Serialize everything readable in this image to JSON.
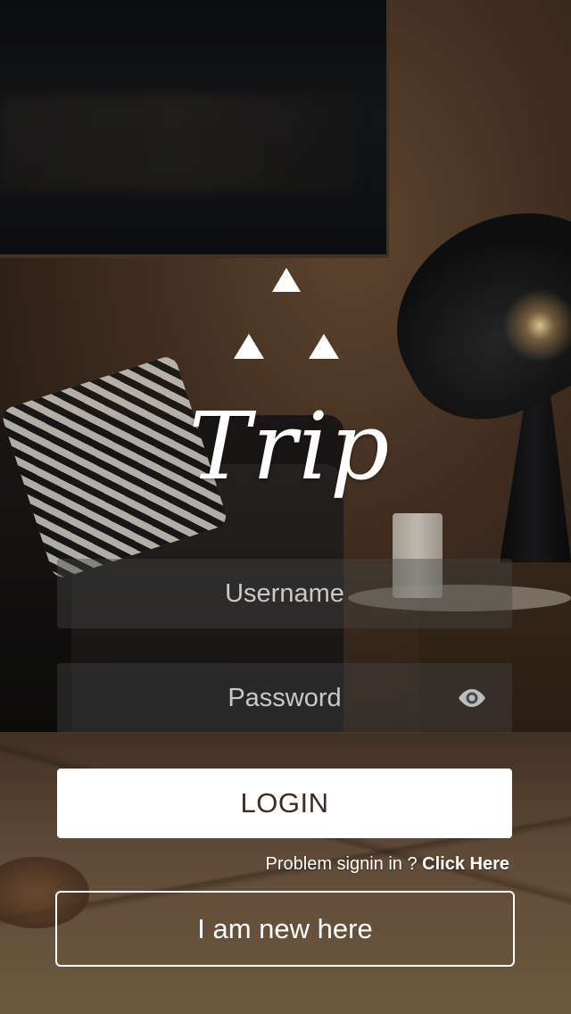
{
  "app": {
    "logo_text": "Trip"
  },
  "form": {
    "username_placeholder": "Username",
    "username_value": "",
    "password_placeholder": "Password",
    "password_value": "",
    "show_password_icon": "eye-icon"
  },
  "actions": {
    "login_label": "LOGIN",
    "problem_text": "Problem signin in ? ",
    "click_here_label": "Click Here",
    "new_user_label": "I am new here"
  },
  "colors": {
    "login_button_bg": "#ffffff",
    "login_button_text": "#3d2c22",
    "field_bg": "rgba(70,70,70,0.42)",
    "text_primary": "#ffffff"
  }
}
